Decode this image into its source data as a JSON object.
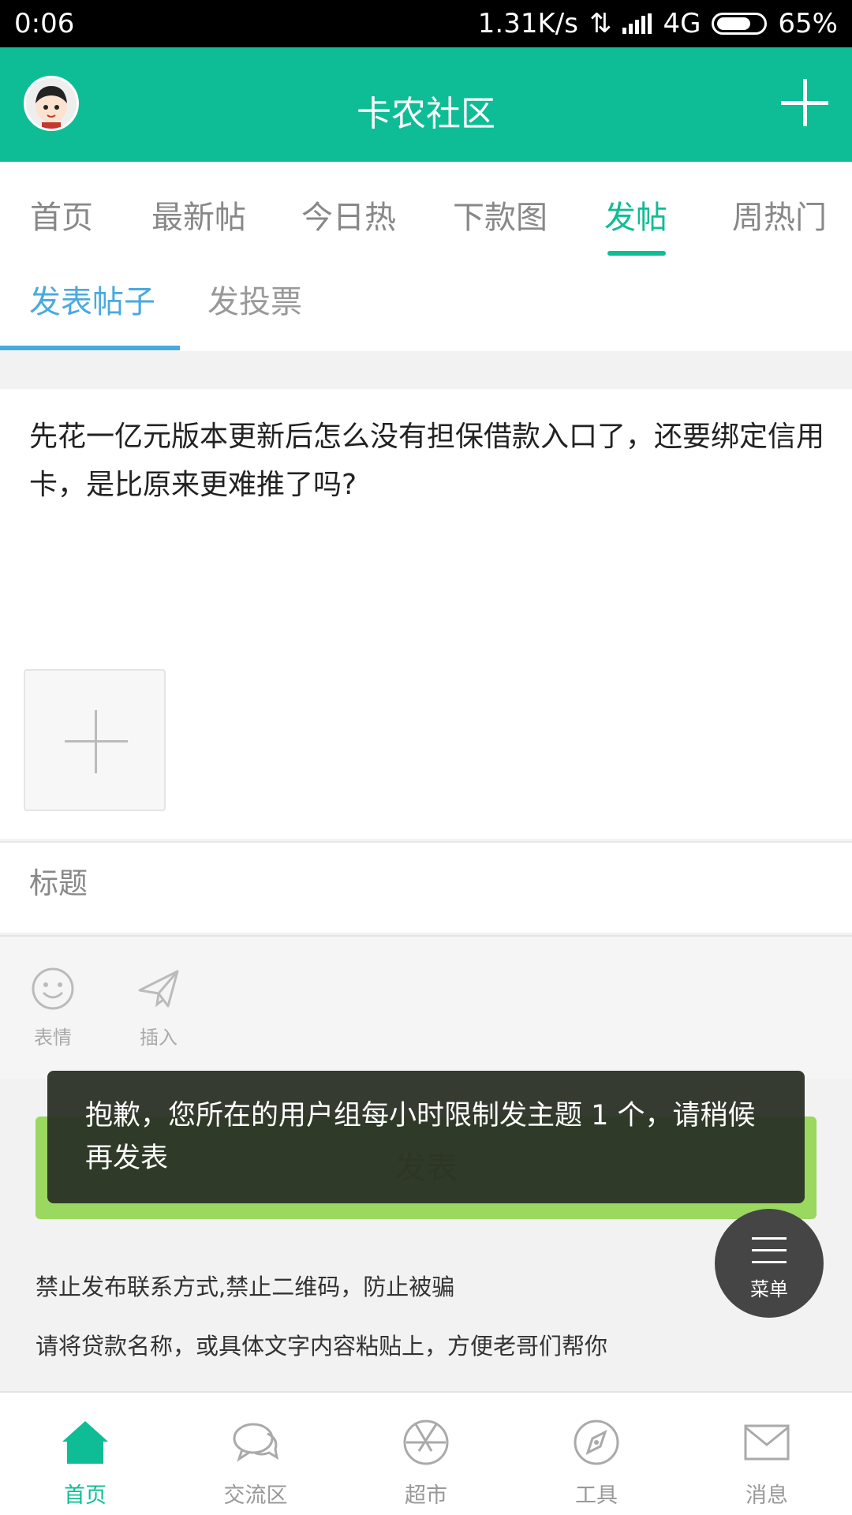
{
  "status_bar": {
    "time": "0:06",
    "speed": "1.31K/s",
    "network": "4G",
    "battery": "65%"
  },
  "app_bar": {
    "title": "卡农社区"
  },
  "tabs": [
    {
      "label": "首页"
    },
    {
      "label": "最新帖"
    },
    {
      "label": "今日热"
    },
    {
      "label": "下款图"
    },
    {
      "label": "发帖",
      "active": true
    },
    {
      "label": "周热门"
    }
  ],
  "subtabs": [
    {
      "label": "发表帖子",
      "active": true
    },
    {
      "label": "发投票"
    }
  ],
  "editor": {
    "content": "先花一亿元版本更新后怎么没有担保借款入口了，还要绑定信用卡，是比原来更难推了吗?"
  },
  "title_field": {
    "placeholder": "标题"
  },
  "toolbar": {
    "emoji_label": "表情",
    "insert_label": "插入"
  },
  "submit_label": "发表",
  "toast": "抱歉，您所在的用户组每小时限制发主题 1 个，请稍候再发表",
  "notices": [
    "禁止发布联系方式,禁止二维码，防止被骗",
    "请将贷款名称，或具体文字内容粘贴上，方便老哥们帮你"
  ],
  "fab_menu_label": "菜单",
  "bottom_nav": [
    {
      "label": "首页",
      "icon": "home-icon",
      "active": true
    },
    {
      "label": "交流区",
      "icon": "chat-icon"
    },
    {
      "label": "超市",
      "icon": "aperture-icon"
    },
    {
      "label": "工具",
      "icon": "compass-icon"
    },
    {
      "label": "消息",
      "icon": "mail-icon"
    }
  ],
  "colors": {
    "primary": "#0ebd95",
    "subtab_accent": "#4aa9e0",
    "submit_button": "#9ad860"
  }
}
